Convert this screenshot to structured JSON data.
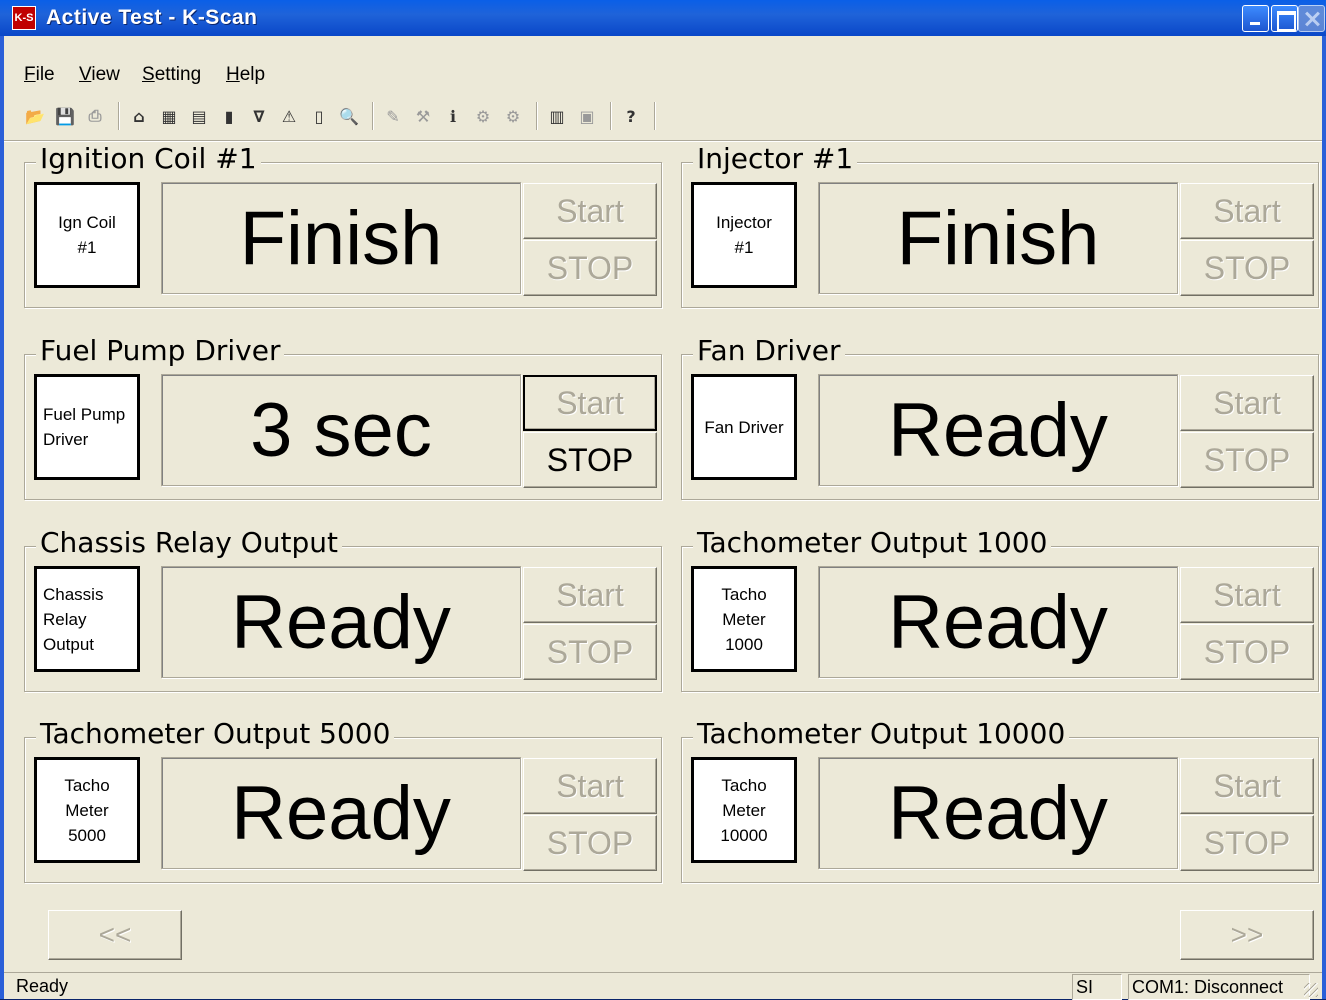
{
  "window": {
    "title": "Active Test - K-Scan",
    "icon_text": "K-S"
  },
  "menu": [
    "File",
    "View",
    "Setting",
    "Help"
  ],
  "toolbar": {
    "groups": [
      [
        {
          "icon": "open-folder-icon",
          "glyph": "📂",
          "dim": true
        },
        {
          "icon": "save-icon",
          "glyph": "💾",
          "dim": true
        },
        {
          "icon": "print-icon",
          "glyph": "⎙",
          "dim": true
        }
      ],
      [
        {
          "icon": "home-icon",
          "glyph": "⌂"
        },
        {
          "icon": "grid-icon",
          "glyph": "▦"
        },
        {
          "icon": "list-icon",
          "glyph": "▤"
        },
        {
          "icon": "bar-chart-icon",
          "glyph": "▮"
        },
        {
          "icon": "filter-icon",
          "glyph": "∇"
        },
        {
          "icon": "warning-icon",
          "glyph": "⚠"
        },
        {
          "icon": "document-icon",
          "glyph": "▯"
        },
        {
          "icon": "preview-icon",
          "glyph": "🔍"
        }
      ],
      [
        {
          "icon": "wrench-icon",
          "glyph": "✎",
          "dim": true
        },
        {
          "icon": "tool-icon",
          "glyph": "⚒",
          "dim": true
        },
        {
          "icon": "info-icon",
          "glyph": "ℹ"
        },
        {
          "icon": "tool2-icon",
          "glyph": "⚙",
          "dim": true
        },
        {
          "icon": "tool3-icon",
          "glyph": "⚙",
          "dim": true
        }
      ],
      [
        {
          "icon": "calculator-icon",
          "glyph": "▥"
        },
        {
          "icon": "window-icon",
          "glyph": "▣",
          "dim": true
        }
      ],
      [
        {
          "icon": "help-icon",
          "glyph": "?"
        }
      ]
    ]
  },
  "tests": [
    {
      "title": "Ignition Coil #1",
      "icon_lines": [
        "Ign Coil",
        "#1"
      ],
      "icon_align": "center",
      "status": "Finish",
      "start_label": "Start",
      "stop_label": "STOP",
      "start_active": false,
      "stop_active": false
    },
    {
      "title": "Injector #1",
      "icon_lines": [
        "Injector",
        "#1"
      ],
      "icon_align": "center",
      "status": "Finish",
      "start_label": "Start",
      "stop_label": "STOP",
      "start_active": false,
      "stop_active": false
    },
    {
      "title": "Fuel Pump Driver",
      "icon_lines": [
        "Fuel Pump",
        "Driver"
      ],
      "icon_align": "left",
      "status": "3 sec",
      "start_label": "Start",
      "stop_label": "STOP",
      "start_active": false,
      "stop_active": true
    },
    {
      "title": "Fan Driver",
      "icon_lines": [
        "Fan Driver"
      ],
      "icon_align": "center",
      "status": "Ready",
      "start_label": "Start",
      "stop_label": "STOP",
      "start_active": false,
      "stop_active": false
    },
    {
      "title": "Chassis Relay Output",
      "icon_lines": [
        "Chassis",
        "Relay",
        "Output"
      ],
      "icon_align": "left",
      "status": "Ready",
      "start_label": "Start",
      "stop_label": "STOP",
      "start_active": false,
      "stop_active": false
    },
    {
      "title": "Tachometer Output 1000",
      "icon_lines": [
        "Tacho",
        "Meter",
        "1000"
      ],
      "icon_align": "center",
      "status": "Ready",
      "start_label": "Start",
      "stop_label": "STOP",
      "start_active": false,
      "stop_active": false
    },
    {
      "title": "Tachometer Output 5000",
      "icon_lines": [
        "Tacho",
        "Meter",
        "5000"
      ],
      "icon_align": "center",
      "status": "Ready",
      "start_label": "Start",
      "stop_label": "STOP",
      "start_active": false,
      "stop_active": false
    },
    {
      "title": "Tachometer Output 10000",
      "icon_lines": [
        "Tacho",
        "Meter",
        "10000"
      ],
      "icon_align": "center",
      "status": "Ready",
      "start_label": "Start",
      "stop_label": "STOP",
      "start_active": false,
      "stop_active": false
    }
  ],
  "nav": {
    "prev_label": "<<",
    "next_label": ">>"
  },
  "statusbar": {
    "message": "Ready",
    "units": "SI",
    "connection": "COM1: Disconnect"
  }
}
